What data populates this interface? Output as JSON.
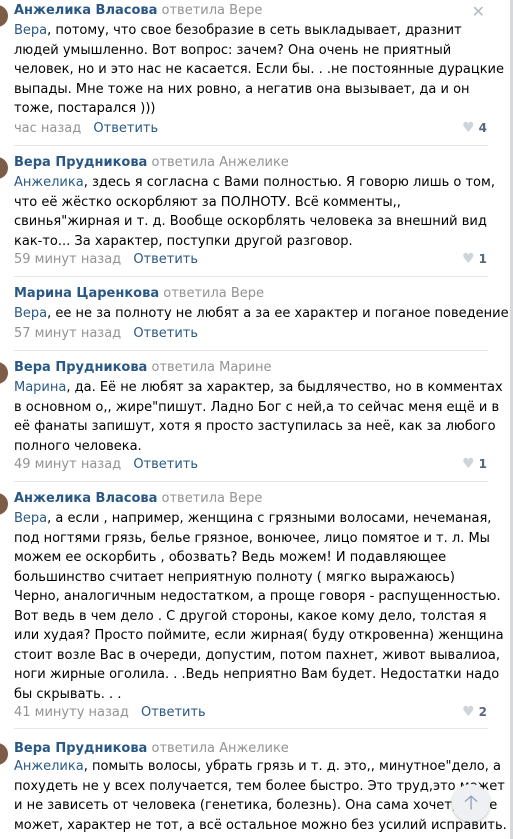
{
  "comments": [
    {
      "author": "Анжелика Власова",
      "replied": "ответила Вере",
      "mention": "Вера",
      "lines": [
        ", потому, что свое безобразие в сеть выкладывает, дразнит",
        "людей умышленно. Вот вопрос: зачем? Она очень не приятный",
        "человек, но и это нас не касается. Если бы. . .не постоянные дурацкие",
        "выпады. Мне тоже на них ровно, а негатив она вызывает, да и он",
        "тоже, постарался )))"
      ],
      "time": "час назад",
      "reply": "Ответить",
      "likes": "4"
    },
    {
      "author": "Вера Прудникова",
      "replied": "ответила Анжелике",
      "mention": "Анжелика",
      "lines": [
        ", здесь я согласна с Вами полностью. Я говорю лишь о том,",
        "что её жёстко оскорбляют за ПОЛНОТУ. Всё комменты,,",
        "свинья\"жирная и т. д. Вообще оскорблять человека за внешний вид",
        "как-то... За характер, поступки другой разговор."
      ],
      "time": "59 минут назад",
      "reply": "Ответить",
      "likes": "1"
    },
    {
      "author": "Марина Царенкова",
      "replied": "ответила Вере",
      "mention": "Вера",
      "lines": [
        ", ее не за полноту не любят а за ее характер и поганое поведение."
      ],
      "time": "57 минут назад",
      "reply": "Ответить",
      "likes": ""
    },
    {
      "author": "Вера Прудникова",
      "replied": "ответила Марине",
      "mention": "Марина",
      "lines": [
        ", да. Её не любят за характер, за быдлячество, но в комментах",
        "в основном о,, жире\"пишут. Ладно Бог с ней,а то сейчас меня ещё и в",
        "её фанаты запишут, хотя я просто заступилась за неё, как за любого",
        "полного человека."
      ],
      "time": "49 минут назад",
      "reply": "Ответить",
      "likes": "1"
    },
    {
      "author": "Анжелика Власова",
      "replied": "ответила Вере",
      "mention": "Вера",
      "lines": [
        ", а если , например, женщина с грязными волосами, нечеманая,",
        "под ногтями грязь, белье грязное, вонючее, лицо помятое и т. л. Мы",
        "можем ее оскорбить , обозвать? Ведь можем! И подавляющее",
        "большинство считает неприятную полноту ( мягко выражаюсь)",
        "Черно, аналогичным недостатком, а проще говоря - распущенностью.",
        "Вот ведь в чем дело . С другой стороны, какое кому дело, толстая я",
        "или худая? Просто поймите, если жирная( буду откровенна) женщина",
        "стоит возле Вас в очереди, допустим, потом пахнет, живот вывалиоа,",
        "ноги жирные оголила. . .Ведь неприятно Вам будет. Недостатки надо",
        "бы скрывать. . ."
      ],
      "time": "41 минуту назад",
      "reply": "Ответить",
      "likes": "2"
    },
    {
      "author": "Вера Прудникова",
      "replied": "ответила Анжелике",
      "mention": "Анжелика",
      "lines": [
        ", помыть волосы, убрать грязь и т. д. это,, минутное\"дело, а",
        "похудеть не у всех получается, тем более быстро. Это труд,это может",
        "и не зависеть от человека (генетика, болезнь). Она сама хочет, но не",
        "может, характер не тот, а всё остальное можно без усилий исправить."
      ],
      "time": "",
      "reply": "",
      "likes": ""
    }
  ],
  "icons": {
    "close": "close-icon",
    "heart": "heart-icon",
    "scroll_up": "arrow-up-icon"
  }
}
